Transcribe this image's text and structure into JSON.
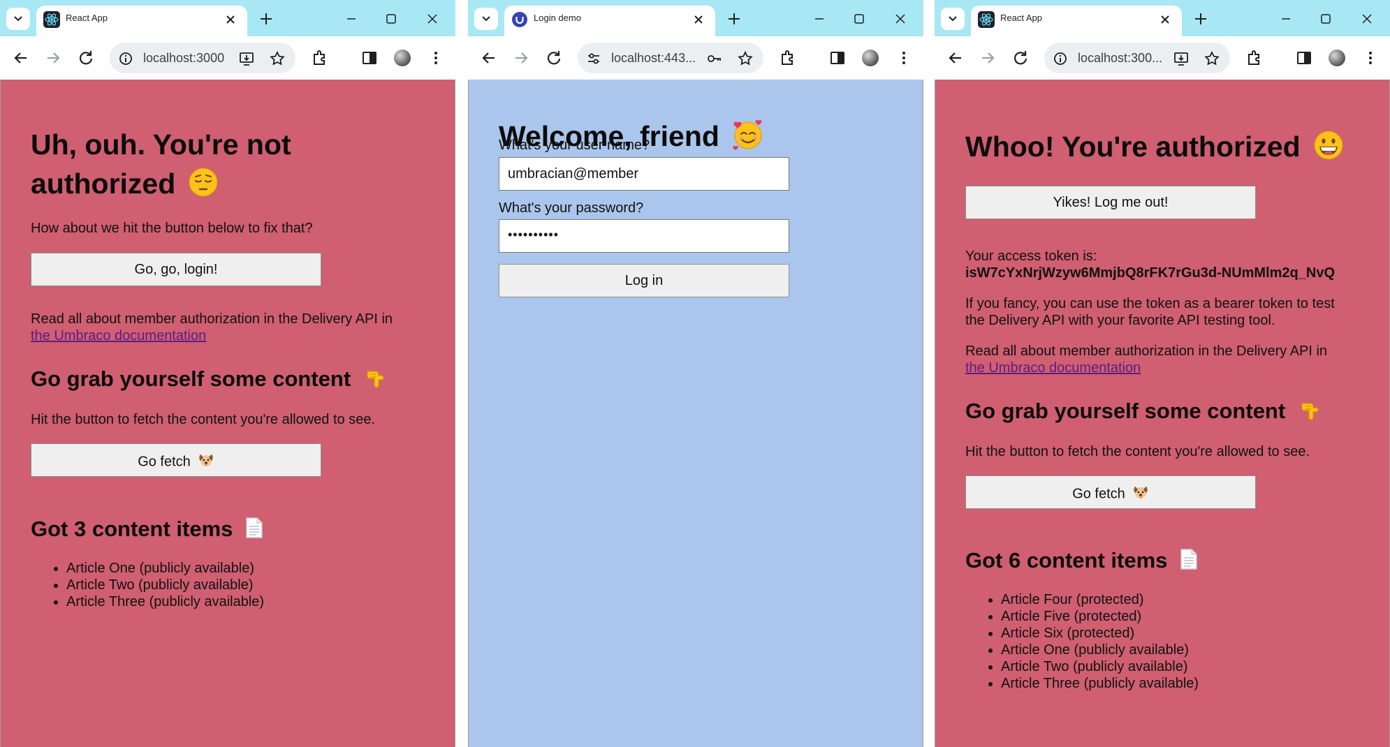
{
  "windows": [
    {
      "tab_title": "React App",
      "url": "localhost:3000",
      "heading_line1": "Uh, ouh. You're not",
      "heading_line2": "authorized",
      "intro": "How about we hit the button below to fix that?",
      "login_button": "Go, go, login!",
      "docs_text": "Read all about member authorization in the Delivery API in",
      "docs_link": "the Umbraco documentation",
      "grab_heading": "Go grab yourself some content",
      "fetch_text": "Hit the button to fetch the content you're allowed to see.",
      "fetch_button": "Go fetch",
      "items_heading": "Got 3 content items",
      "items": [
        "Article One (publicly available)",
        "Article Two (publicly available)",
        "Article Three (publicly available)"
      ]
    },
    {
      "tab_title": "Login demo",
      "url": "localhost:443...",
      "heading": "Welcome, friend",
      "username_label": "What's your user name?",
      "username_value": "umbracian@member",
      "password_label": "What's your password?",
      "password_value": "••••••••••",
      "login_button": "Log in"
    },
    {
      "tab_title": "React App",
      "url": "localhost:300...",
      "heading": "Whoo! You're authorized",
      "logout_button": "Yikes! Log me out!",
      "token_label": "Your access token is:",
      "token_value": "isW7cYxNrjWzyw6MmjbQ8rFK7rGu3d-NUmMlm2q_NvQ",
      "bearer_line1": "If you fancy, you can use the token as a bearer token to test",
      "bearer_line2": "the Delivery API with your favorite API testing tool.",
      "docs_text": "Read all about member authorization in the Delivery API in",
      "docs_link": "the Umbraco documentation",
      "grab_heading": "Go grab yourself some content",
      "fetch_text": "Hit the button to fetch the content you're allowed to see.",
      "fetch_button": "Go fetch",
      "items_heading": "Got 6 content items",
      "items": [
        "Article Four (protected)",
        "Article Five (protected)",
        "Article Six (protected)",
        "Article One (publicly available)",
        "Article Two (publicly available)",
        "Article Three (publicly available)"
      ]
    }
  ],
  "icons": {
    "tab_search": "chevron-down-icon",
    "favicon_react": "react-logo-icon",
    "favicon_login": "umbraco-logo-icon",
    "tab_close": "close-icon",
    "new_tab": "plus-icon",
    "minimize": "minimize-icon",
    "maximize": "maximize-icon",
    "close_window": "close-window-icon",
    "back": "back-arrow-icon",
    "forward": "forward-arrow-icon",
    "reload": "reload-icon",
    "site_info": "info-icon",
    "site_settings": "tune-icon",
    "install_app": "install-icon",
    "password_key": "key-icon",
    "bookmark": "star-icon",
    "extensions": "puzzle-icon",
    "side_panel": "side-panel-icon",
    "profile": "avatar-icon",
    "menu": "kebab-menu-icon",
    "pensive_emoji": "pensive-face-icon",
    "hearts_emoji": "smiling-face-with-hearts-icon",
    "grin_emoji": "grinning-face-icon",
    "point_emoji": "pointing-down-icon",
    "dog_emoji": "dog-face-icon",
    "page_emoji": "page-icon"
  },
  "colors": {
    "tabstrip": "#a8e8f4",
    "unauthorized_bg": "#cf5f71",
    "login_bg": "#abc6ec",
    "link": "#5b1c86",
    "button_bg": "#efefef"
  }
}
